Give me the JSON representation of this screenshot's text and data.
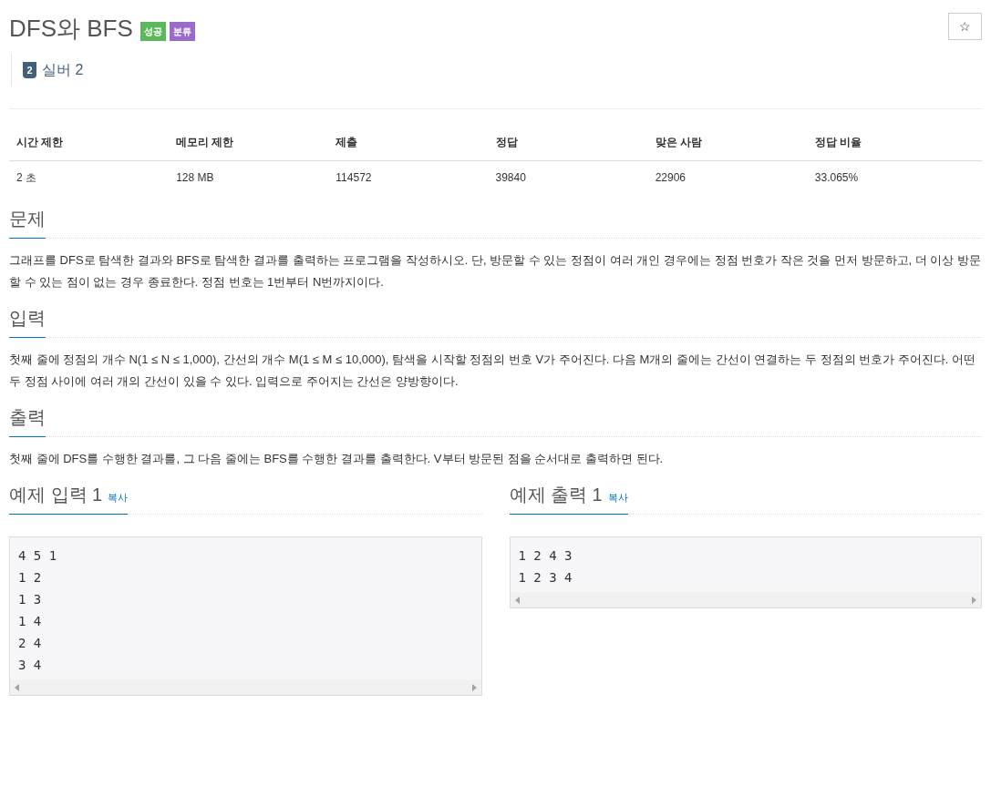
{
  "title": "DFS와 BFS",
  "badges": [
    {
      "label": "성공",
      "color": "#5cb85c"
    },
    {
      "label": "분류",
      "color": "#9b6bcc"
    }
  ],
  "tier": {
    "icon_text": "2",
    "label": "실버 2"
  },
  "favorite_button": {
    "label": "☆"
  },
  "stats": {
    "columns": [
      "시간 제한",
      "메모리 제한",
      "제출",
      "정답",
      "맞은 사람",
      "정답 비율"
    ],
    "row": [
      "2 초",
      "128 MB",
      "114572",
      "39840",
      "22906",
      "33.065%"
    ]
  },
  "sections": [
    {
      "heading": "문제",
      "text": "그래프를 DFS로 탐색한 결과와 BFS로 탐색한 결과를 출력하는 프로그램을 작성하시오. 단, 방문할 수 있는 정점이 여러 개인 경우에는 정점 번호가 작은 것을 먼저 방문하고, 더 이상 방문할 수 있는 점이 없는 경우 종료한다. 정점 번호는 1번부터 N번까지이다."
    },
    {
      "heading": "입력",
      "text": "첫째 줄에 정점의 개수 N(1 ≤ N ≤ 1,000), 간선의 개수 M(1 ≤ M ≤ 10,000), 탐색을 시작할 정점의 번호 V가 주어진다. 다음 M개의 줄에는 간선이 연결하는 두 정점의 번호가 주어진다. 어떤 두 정점 사이에 여러 개의 간선이 있을 수 있다. 입력으로 주어지는 간선은 양방향이다."
    },
    {
      "heading": "출력",
      "text": "첫째 줄에 DFS를 수행한 결과를, 그 다음 줄에는 BFS를 수행한 결과를 출력한다. V부터 방문된 점을 순서대로 출력하면 된다."
    }
  ],
  "samples": [
    {
      "heading": "예제 입력 1",
      "copy_link": "복사",
      "lines": [
        "4 5 1",
        "1 2",
        "1 3",
        "1 4",
        "2 4",
        "3 4"
      ]
    },
    {
      "heading": "예제 출력 1",
      "copy_link": "복사",
      "lines": [
        "1 2 4 3",
        "1 2 3 4"
      ]
    }
  ]
}
